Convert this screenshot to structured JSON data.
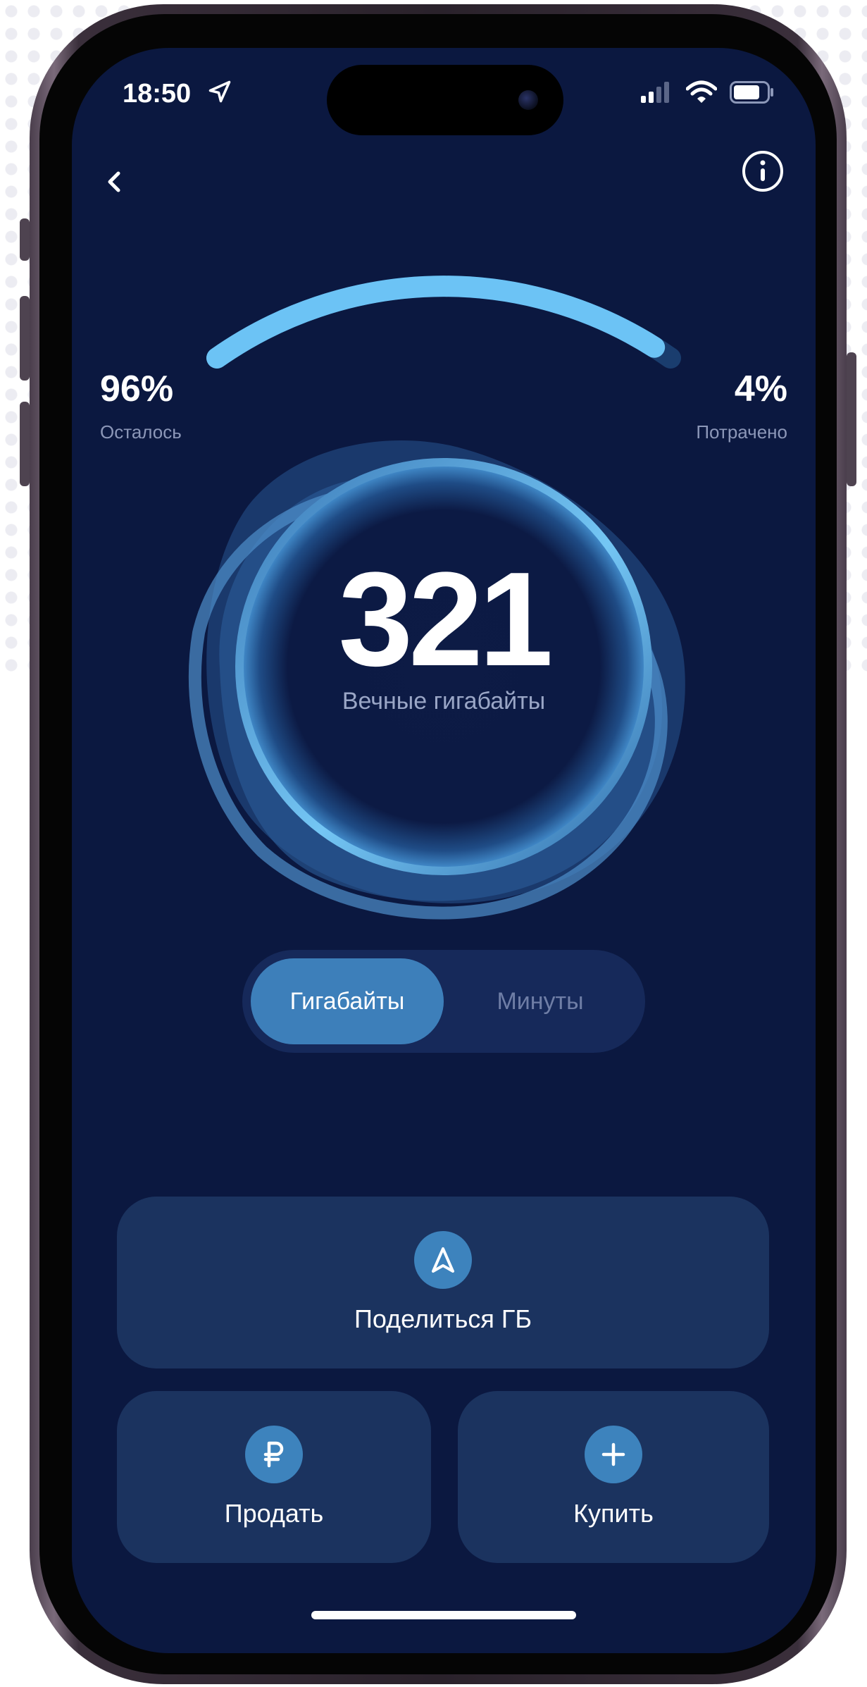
{
  "status_bar": {
    "time": "18:50"
  },
  "header": {
    "back_icon": "chevron-left-icon",
    "info_icon": "info-icon"
  },
  "usage": {
    "remaining_percent": "96%",
    "remaining_label": "Осталось",
    "spent_percent": "4%",
    "spent_label": "Потрачено",
    "remaining_fraction": 0.96
  },
  "balance": {
    "value": "321",
    "label": "Вечные гигабайты"
  },
  "tabs": [
    {
      "label": "Гигабайты",
      "active": true
    },
    {
      "label": "Минуты",
      "active": false
    }
  ],
  "actions": {
    "share_label": "Поделиться ГБ",
    "sell_label": "Продать",
    "buy_label": "Купить"
  },
  "colors": {
    "background": "#0b1840",
    "accent": "#3d83bd",
    "arc": "#6cc3f5",
    "card": "#1b335f"
  }
}
